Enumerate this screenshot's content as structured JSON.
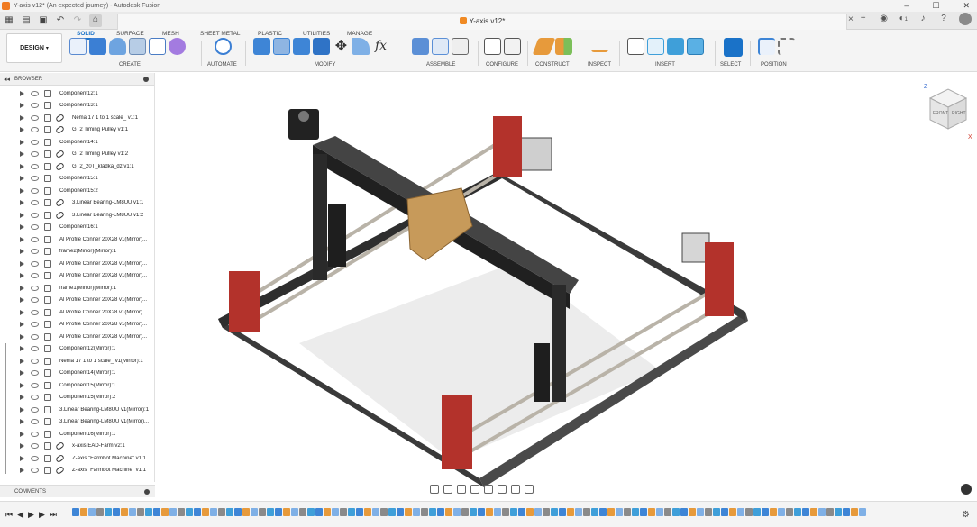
{
  "window": {
    "title": "Y-axis v12* (An expected journey) - Autodesk Fusion",
    "controls": [
      "–",
      "☐",
      "✕"
    ]
  },
  "document_tab": {
    "title": "Y-axis v12*",
    "close": "×"
  },
  "notifications": {
    "jobs_count": "1"
  },
  "ribbon": {
    "workspace_button": "DESIGN",
    "tabs": [
      "SOLID",
      "SURFACE",
      "MESH",
      "SHEET METAL",
      "PLASTIC",
      "UTILITIES",
      "MANAGE"
    ],
    "active_tab": "SOLID",
    "groups": [
      "CREATE",
      "AUTOMATE",
      "MODIFY",
      "ASSEMBLE",
      "CONFIGURE",
      "CONSTRUCT",
      "INSPECT",
      "INSERT",
      "SELECT",
      "POSITION"
    ],
    "colors": {
      "accent": "#1a72c8",
      "create": "#6b9bd8",
      "modify": "#3e85d6",
      "construct": "#e79a3b",
      "insert": "#3f9fd9"
    }
  },
  "browser": {
    "title": "BROWSER",
    "items": [
      {
        "name": "Component12:1",
        "linked": false
      },
      {
        "name": "Component13:1",
        "linked": false
      },
      {
        "name": "Nema 17 1 to 1 scale_ v1:1",
        "linked": true
      },
      {
        "name": "GT2 Timing Pulley v1:1",
        "linked": true
      },
      {
        "name": "Component14:1",
        "linked": false
      },
      {
        "name": "GT2 Timing Pulley v1:2",
        "linked": true
      },
      {
        "name": "GT2_20T_kladka_dz v1:1",
        "linked": true
      },
      {
        "name": "Component15:1",
        "linked": false
      },
      {
        "name": "Component15:2",
        "linked": false
      },
      {
        "name": "3.Linear Bearing-LM8UU v1:1",
        "linked": true
      },
      {
        "name": "3.Linear Bearing-LM8UU v1:2",
        "linked": true
      },
      {
        "name": "Component16:1",
        "linked": false
      },
      {
        "name": "Al Profile Conner 20X28 v1(Mirror)...",
        "linked": false
      },
      {
        "name": "frame2(Mirror)(Mirror):1",
        "linked": false
      },
      {
        "name": "Al Profile Conner 20X28 v1(Mirror)...",
        "linked": false
      },
      {
        "name": "Al Profile Conner 20X28 v1(Mirror)...",
        "linked": false
      },
      {
        "name": "frame1(Mirror)(Mirror):1",
        "linked": false
      },
      {
        "name": "Al Profile Conner 20X28 v1(Mirror)...",
        "linked": false
      },
      {
        "name": "Al Profile Conner 20X28 v1(Mirror)...",
        "linked": false
      },
      {
        "name": "Al Profile Conner 20X28 v1(Mirror)...",
        "linked": false
      },
      {
        "name": "Al Profile Conner 20X28 v1(Mirror)...",
        "linked": false
      },
      {
        "name": "Component12(Mirror):1",
        "linked": false
      },
      {
        "name": "Nema 17 1 to 1 scale_ v1(Mirror):1",
        "linked": false
      },
      {
        "name": "Component14(Mirror):1",
        "linked": false
      },
      {
        "name": "Component15(Mirror):1",
        "linked": false
      },
      {
        "name": "Component15(Mirror):2",
        "linked": false
      },
      {
        "name": "3.Linear Bearing-LM8UU v1(Mirror):1",
        "linked": false
      },
      {
        "name": "3.Linear Bearing-LM8UU v1(Mirror)...",
        "linked": false
      },
      {
        "name": "Component16(Mirror):1",
        "linked": false
      },
      {
        "name": "x-axis EAD-Farm v2:1",
        "linked": true
      },
      {
        "name": "Z-axis \"Farmbot Machine\" v1:1",
        "linked": true
      },
      {
        "name": "Z-axis \"Farmbot Machine\" v1:1",
        "linked": true
      }
    ]
  },
  "comments": {
    "title": "COMMENTS"
  },
  "viewcube": {
    "faces": [
      "FRONT",
      "RIGHT"
    ],
    "axes": [
      "Z",
      "X"
    ]
  },
  "timeline": {
    "controls": [
      "⏮",
      "◀",
      "▶",
      "▶",
      "⏭"
    ]
  }
}
